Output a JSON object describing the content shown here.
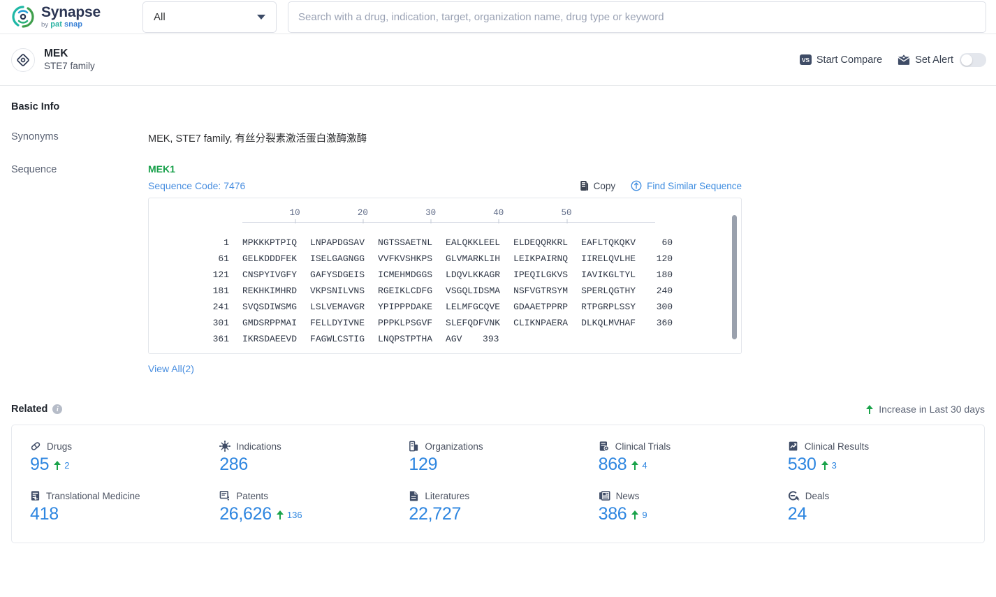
{
  "topbar": {
    "logo": {
      "title": "Synapse",
      "by": "by",
      "brand_part1": "pat",
      "brand_part2": "snap"
    },
    "scope_select": {
      "value": "All",
      "icon": "chevron-down-icon"
    },
    "search": {
      "value": "",
      "placeholder": "Search with a drug, indication, target, organization name, drug type or keyword"
    }
  },
  "entity": {
    "icon": "target-icon",
    "name": "MEK",
    "subtitle": "STE7 family",
    "actions": {
      "compare_badge": "VS",
      "compare_label": "Start Compare",
      "alert_icon": "mail-alert-icon",
      "alert_label": "Set Alert",
      "alert_enabled": false
    }
  },
  "basic_info": {
    "title": "Basic Info",
    "synonyms_label": "Synonyms",
    "synonyms_value": "MEK, STE7 family, 有丝分裂素激活蛋白激酶激酶",
    "sequence_label": "Sequence",
    "sequence_name": "MEK1",
    "sequence_code": "Sequence Code: 7476",
    "copy_label": "Copy",
    "copy_icon": "copy-icon",
    "find_similar_label": "Find Similar Sequence",
    "find_similar_icon": "find-similar-icon",
    "view_all_label": "View All(2)",
    "ruler_ticks": [
      10,
      20,
      30,
      40,
      50
    ],
    "sequence_rows": [
      {
        "start": "1",
        "blocks": [
          "MPKKKPTPIQ",
          "LNPAPDGSAV",
          "NGTSSAETNL",
          "EALQKKLEEL",
          "ELDEQQRKRL",
          "EAFLTQKQKV"
        ],
        "end": "60"
      },
      {
        "start": "61",
        "blocks": [
          "GELKDDDFEK",
          "ISELGAGNGG",
          "VVFKVSHKPS",
          "GLVMARKLIH",
          "LEIKPAIRNQ",
          "IIRELQVLHE"
        ],
        "end": "120"
      },
      {
        "start": "121",
        "blocks": [
          "CNSPYIVGFY",
          "GAFYSDGEIS",
          "ICMEHMDGGS",
          "LDQVLKKAGR",
          "IPEQILGKVS",
          "IAVIKGLTYL"
        ],
        "end": "180"
      },
      {
        "start": "181",
        "blocks": [
          "REKHKIMHRD",
          "VKPSNILVNS",
          "RGEIKLCDFG",
          "VSGQLIDSMA",
          "NSFVGTRSYM",
          "SPERLQGTHY"
        ],
        "end": "240"
      },
      {
        "start": "241",
        "blocks": [
          "SVQSDIWSMG",
          "LSLVEMAVGR",
          "YPIPPPDAKE",
          "LELMFGCQVE",
          "GDAAETPPRP",
          "RTPGRPLSSY"
        ],
        "end": "300"
      },
      {
        "start": "301",
        "blocks": [
          "GMDSRPPMAI",
          "FELLDYIVNE",
          "PPPKLPSGVF",
          "SLEFQDFVNK",
          "CLIKNPAERA",
          "DLKQLMVHAF"
        ],
        "end": "360"
      },
      {
        "start": "361",
        "blocks": [
          "IKRSDAEEVD",
          "FAGWLCSTIG",
          "LNQPSTPTHA",
          "AGV"
        ],
        "end": "393"
      }
    ]
  },
  "related": {
    "title": "Related",
    "info_icon": "info-icon",
    "legend_icon": "arrow-up-icon",
    "legend_label": "Increase in Last 30 days",
    "stats": [
      {
        "icon": "pill-icon",
        "label": "Drugs",
        "value": "95",
        "delta": "2"
      },
      {
        "icon": "virus-icon",
        "label": "Indications",
        "value": "286",
        "delta": ""
      },
      {
        "icon": "building-icon",
        "label": "Organizations",
        "value": "129",
        "delta": ""
      },
      {
        "icon": "clinical-trials-icon",
        "label": "Clinical Trials",
        "value": "868",
        "delta": "4"
      },
      {
        "icon": "clinical-results-icon",
        "label": "Clinical Results",
        "value": "530",
        "delta": "3"
      },
      {
        "icon": "translational-icon",
        "label": "Translational Medicine",
        "value": "418",
        "delta": ""
      },
      {
        "icon": "patents-icon",
        "label": "Patents",
        "value": "26,626",
        "delta": "136"
      },
      {
        "icon": "literature-icon",
        "label": "Literatures",
        "value": "22,727",
        "delta": ""
      },
      {
        "icon": "news-icon",
        "label": "News",
        "value": "386",
        "delta": "9"
      },
      {
        "icon": "deals-icon",
        "label": "Deals",
        "value": "24",
        "delta": ""
      }
    ]
  },
  "colors": {
    "accent_blue": "#2e86e0",
    "link_blue": "#4a8fe0",
    "green": "#17a04a",
    "delta_green": "#1aa34a",
    "icon_navy": "#3f4c66"
  }
}
